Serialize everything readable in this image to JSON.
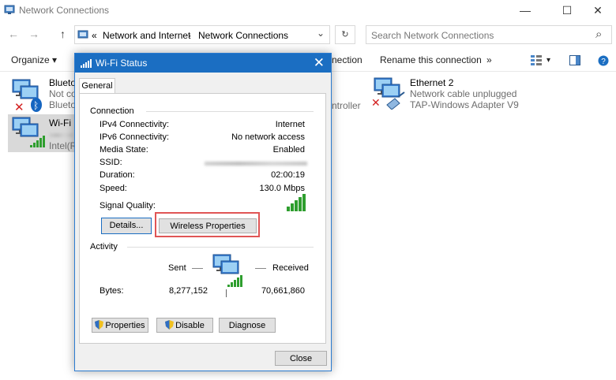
{
  "window": {
    "title": "Network Connections",
    "minimize_glyph": "—",
    "maximize_glyph": "☐",
    "close_glyph": "✕"
  },
  "address_bar": {
    "back_glyph": "←",
    "forward_glyph": "→",
    "up_glyph": "↑",
    "prefix": "«",
    "segments": [
      "Network and Internet",
      "Network Connections"
    ],
    "separator": "›",
    "dropdown_glyph": "⌄",
    "refresh_glyph": "↻",
    "search_placeholder": "Search Network Connections",
    "search_glyph": "⌕"
  },
  "toolbar": {
    "organize": "Organize ▾",
    "rename": "Rename this connection",
    "partial_behind": "nection",
    "more": "»",
    "view_glyph": "▾"
  },
  "connections": [
    {
      "name": "Bluetoo",
      "line2": "Not co",
      "line3": "Blueto",
      "status_color": "#d32020"
    },
    {
      "name": "Wi-Fi",
      "line2": "",
      "line3": "Intel(R",
      "selected": true
    },
    {
      "name": "Ethernet 2",
      "line2": "Network cable unplugged",
      "line3": "TAP-Windows Adapter V9"
    },
    {
      "partial": "ntroller"
    }
  ],
  "dialog": {
    "title": "Wi-Fi Status",
    "close_glyph": "✕",
    "tab": "General",
    "connection_heading": "Connection",
    "rows": [
      {
        "label": "IPv4 Connectivity:",
        "value": "Internet"
      },
      {
        "label": "IPv6 Connectivity:",
        "value": "No network access"
      },
      {
        "label": "Media State:",
        "value": "Enabled"
      },
      {
        "label": "SSID:",
        "value": ""
      },
      {
        "label": "Duration:",
        "value": "02:00:19"
      },
      {
        "label": "Speed:",
        "value": "130.0 Mbps"
      }
    ],
    "signal_label": "Signal Quality:",
    "signal_bars": 5,
    "signal_level_of_5": 5,
    "details_button": "Details...",
    "wireless_button": "Wireless Properties",
    "activity_heading": "Activity",
    "sent_label": "Sent",
    "received_label": "Received",
    "bytes_label": "Bytes:",
    "bytes_sent": "8,277,152",
    "bytes_received": "70,661,860",
    "properties_button": "Properties",
    "disable_button": "Disable",
    "diagnose_button": "Diagnose",
    "close_button": "Close"
  },
  "colors": {
    "title_bar": "#1b6ec2",
    "highlight": "#e05555",
    "signal_green": "#2e9e2e",
    "selected_item": "#d9d9d9"
  }
}
